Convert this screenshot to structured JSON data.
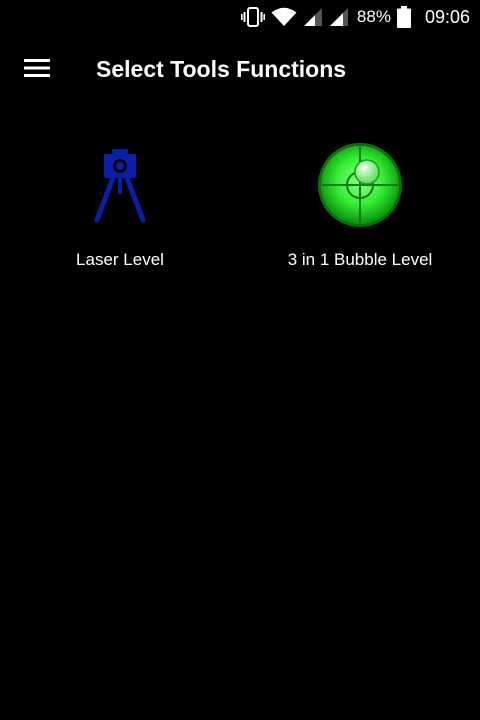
{
  "status_bar": {
    "battery_percent": "88%",
    "time": "09:06",
    "icons": [
      "vibrate-icon",
      "wifi-icon",
      "signal-icon",
      "signal-icon",
      "battery-icon"
    ]
  },
  "app_bar": {
    "title": "Select Tools Functions",
    "menu_icon": "hamburger-menu-icon"
  },
  "tools": [
    {
      "label": "Laser Level",
      "icon": "tripod-laser-icon",
      "icon_color": "#0a1fa8"
    },
    {
      "label": "3 in 1 Bubble Level",
      "icon": "bubble-level-icon",
      "icon_color": "#33ff33"
    }
  ],
  "colors": {
    "background": "#000000",
    "text": "#ffffff"
  }
}
